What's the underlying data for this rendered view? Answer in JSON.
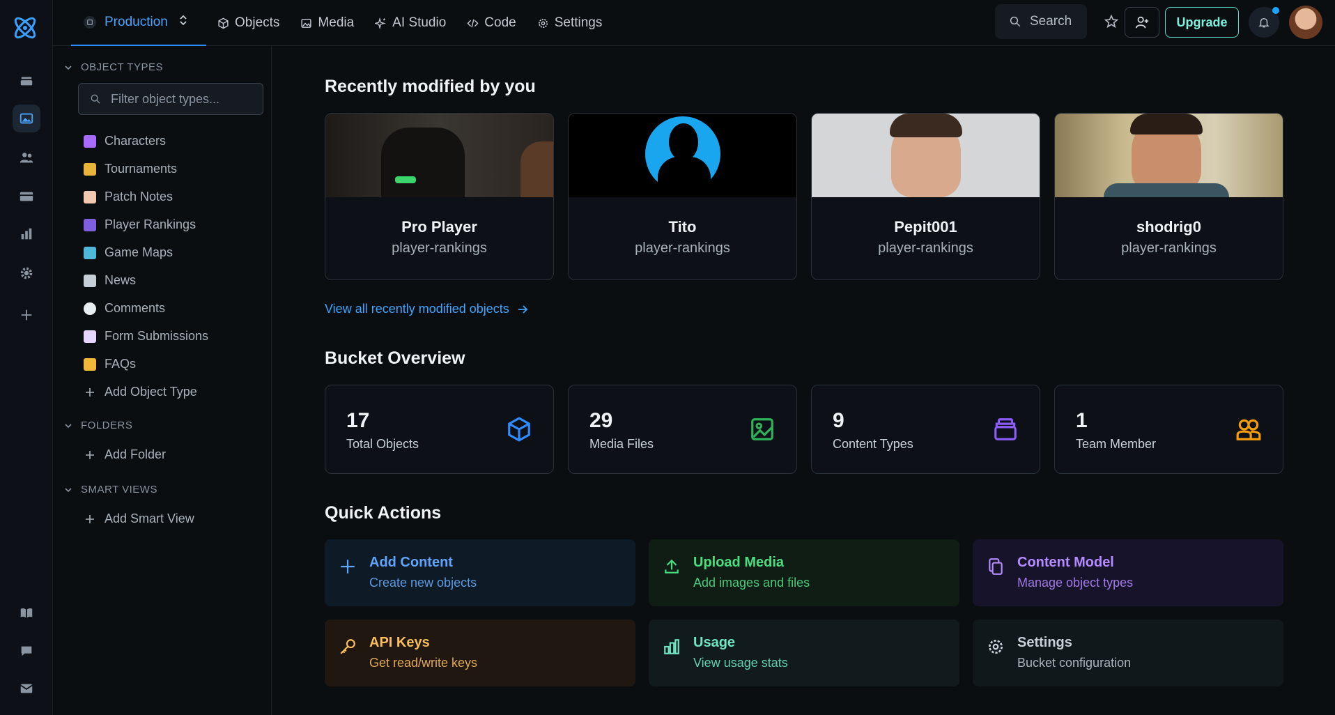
{
  "topbar": {
    "environment": "Production",
    "nav": [
      {
        "label": "Objects",
        "icon": "cube-icon"
      },
      {
        "label": "Media",
        "icon": "image-icon"
      },
      {
        "label": "AI Studio",
        "icon": "sparkle-icon"
      },
      {
        "label": "Code",
        "icon": "code-icon"
      },
      {
        "label": "Settings",
        "icon": "gear-icon"
      }
    ],
    "search_label": "Search",
    "upgrade_label": "Upgrade"
  },
  "sidebar": {
    "object_types_heading": "OBJECT TYPES",
    "filter_placeholder": "Filter object types...",
    "object_types": [
      {
        "label": "Characters",
        "emoji_color": "#a76cff"
      },
      {
        "label": "Tournaments",
        "emoji_color": "#e9b43a"
      },
      {
        "label": "Patch Notes",
        "emoji_color": "#f1c8b1"
      },
      {
        "label": "Player Rankings",
        "emoji_color": "#7f5fe0"
      },
      {
        "label": "Game Maps",
        "emoji_color": "#4fb7d8"
      },
      {
        "label": "News",
        "emoji_color": "#c7ced6"
      },
      {
        "label": "Comments",
        "emoji_color": "#e9eef3"
      },
      {
        "label": "Form Submissions",
        "emoji_color": "#e6d6ff"
      },
      {
        "label": "FAQs",
        "emoji_color": "#f2b83a"
      }
    ],
    "add_object_type": "Add Object Type",
    "folders_heading": "FOLDERS",
    "add_folder": "Add Folder",
    "smart_views_heading": "SMART VIEWS",
    "add_smart_view": "Add Smart View"
  },
  "recent": {
    "heading": "Recently modified by you",
    "cards": [
      {
        "name": "Pro Player",
        "type": "player-rankings"
      },
      {
        "name": "Tito",
        "type": "player-rankings"
      },
      {
        "name": "Pepit001",
        "type": "player-rankings"
      },
      {
        "name": "shodrig0",
        "type": "player-rankings"
      }
    ],
    "view_all": "View all recently modified objects"
  },
  "overview": {
    "heading": "Bucket Overview",
    "stats": [
      {
        "value": "17",
        "label": "Total Objects",
        "color": "#2f8cff"
      },
      {
        "value": "29",
        "label": "Media Files",
        "color": "#2fb35a"
      },
      {
        "value": "9",
        "label": "Content Types",
        "color": "#8a5cf6"
      },
      {
        "value": "1",
        "label": "Team Member",
        "color": "#f59e0b"
      }
    ]
  },
  "quick_actions": {
    "heading": "Quick Actions",
    "items": [
      {
        "title": "Add Content",
        "subtitle": "Create new objects",
        "color": "#60a5fa",
        "sub_color": "#5b9be0",
        "bg": "#0e1a26"
      },
      {
        "title": "Upload Media",
        "subtitle": "Add images and files",
        "color": "#4ade80",
        "sub_color": "#4cc97a",
        "bg": "#0f1d15"
      },
      {
        "title": "Content Model",
        "subtitle": "Manage object types",
        "color": "#b48cff",
        "sub_color": "#a27ae8",
        "bg": "#17132a"
      },
      {
        "title": "API Keys",
        "subtitle": "Get read/write keys",
        "color": "#fbbf5a",
        "sub_color": "#e0a850",
        "bg": "#1f1710"
      },
      {
        "title": "Usage",
        "subtitle": "View usage stats",
        "color": "#6ee7c5",
        "sub_color": "#5fd1b3",
        "bg": "#111a1c"
      },
      {
        "title": "Settings",
        "subtitle": "Bucket configuration",
        "color": "#c9d1d9",
        "sub_color": "#aab2bb",
        "bg": "#11181c"
      }
    ]
  }
}
